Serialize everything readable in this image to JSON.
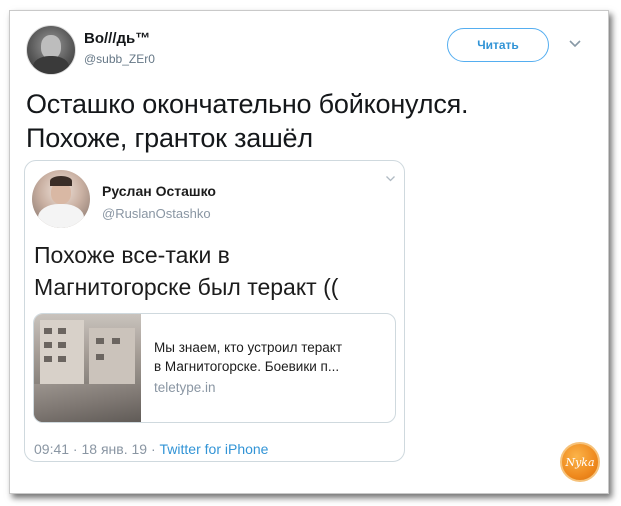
{
  "tweet": {
    "author_name": "Во///дь™",
    "author_handle": "@subb_ZEr0",
    "follow_label": "Читать",
    "text_lines": [
      "Осташко окончательно бойконулся.",
      "Похоже, гранток зашёл"
    ]
  },
  "quoted": {
    "author_name": "Руслан Осташко",
    "author_handle": "@RuslanOstashko",
    "text_lines": [
      "Похоже все-таки в",
      "Магнитогорске был теракт (("
    ],
    "card": {
      "title_lines": [
        "Мы знаем, кто устроил теракт",
        "в Магнитогорске. Боевики п..."
      ],
      "domain": "teletype.in"
    },
    "meta": {
      "time": "09:41",
      "date": "18 янв. 19",
      "source": "Twitter for iPhone"
    }
  },
  "watermark": {
    "text": "Nyka",
    "color": "#ef8a1e"
  },
  "colors": {
    "accent": "#3294d6",
    "muted": "#657786",
    "border": "#cfd9de"
  }
}
